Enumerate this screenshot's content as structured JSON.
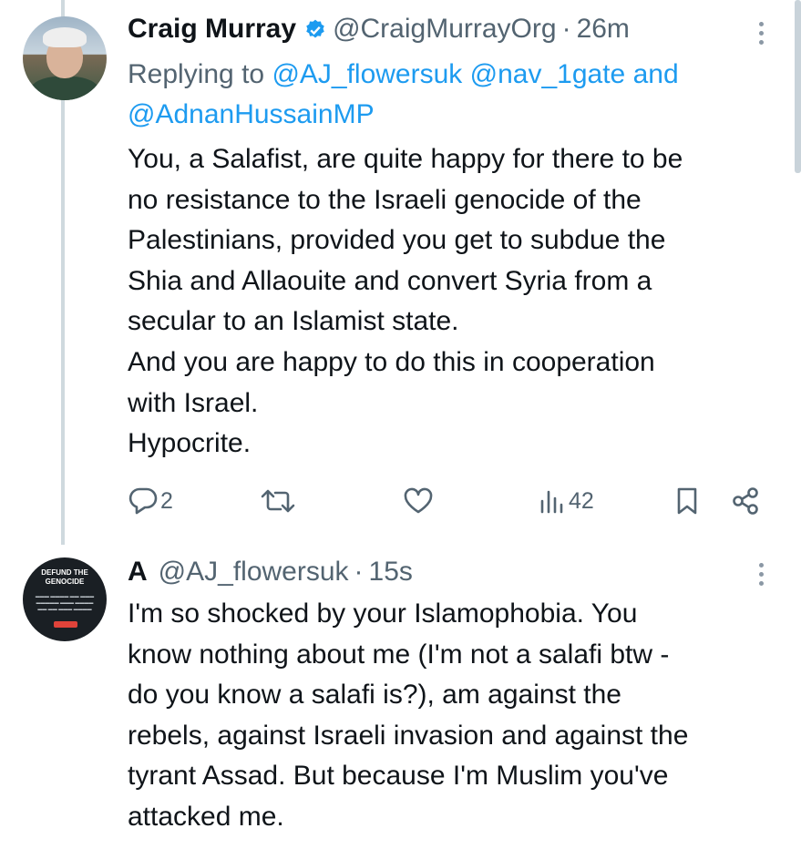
{
  "tweet1": {
    "name": "Craig Murray",
    "handle": "@CraigMurrayOrg",
    "separator": "·",
    "time": "26m",
    "replying_prefix": "Replying to",
    "mention_1": "@AJ_flowersuk",
    "mention_2": "@nav_1gate",
    "mention_and": "and",
    "mention_3": "@AdnanHussainMP",
    "text": "You, a Salafist, are quite happy for there to be\nno resistance to the Israeli genocide of the\nPalestinians, provided you get to subdue the\nShia and Allaouite and convert Syria from a\nsecular to an Islamist state.\nAnd you are happy to do this in cooperation\nwith Israel.\nHypocrite.",
    "reply_count": "2",
    "view_count": "42"
  },
  "tweet2": {
    "name": "A",
    "handle": "@AJ_flowersuk",
    "separator": "·",
    "time": "15s",
    "avatar_title": "DEFUND THE GENOCIDE",
    "text": "I'm so shocked by your Islamophobia. You\nknow nothing about me (I'm not a salafi btw -\ndo you know a salafi is?), am against the\nrebels, against Israeli invasion and against the\ntyrant Assad. But because I'm Muslim you've\nattacked me."
  },
  "colors": {
    "text": "#0f1419",
    "secondary": "#536471",
    "link": "#1d9bf0",
    "thread_line": "#cfd9de"
  },
  "icons": {
    "verified": "verified-badge-icon",
    "more": "more-vertical-icon",
    "reply": "reply-icon",
    "retweet": "retweet-icon",
    "like": "heart-icon",
    "views": "views-icon",
    "bookmark": "bookmark-icon",
    "share": "share-icon"
  }
}
